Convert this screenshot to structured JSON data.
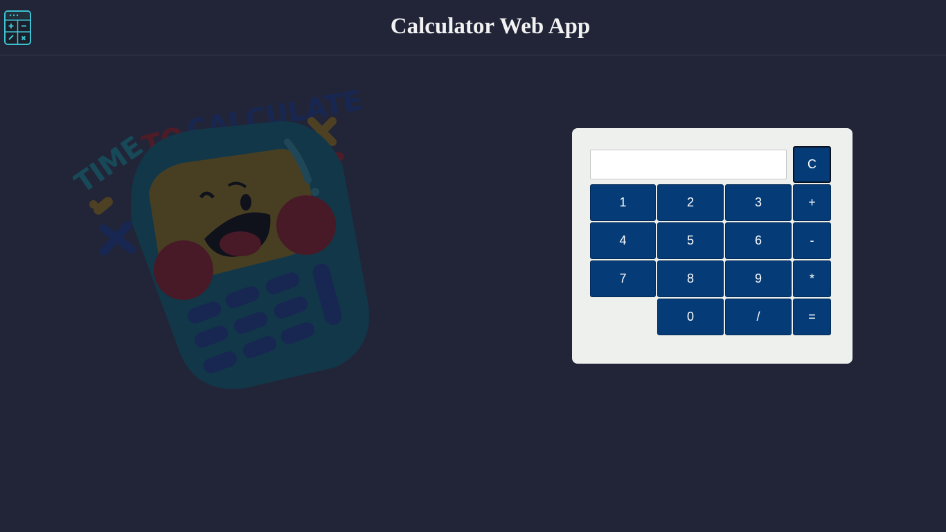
{
  "header": {
    "title": "Calculator Web App",
    "logo_icon": "calculator-icon"
  },
  "illustration": {
    "text_time": "TIME",
    "text_to": "TO",
    "text_calculate": "CALCULATE",
    "icon": "happy-calculator-illustration"
  },
  "calculator": {
    "display_value": "",
    "display_placeholder": "",
    "clear_label": "C",
    "keys": {
      "k1": "1",
      "k2": "2",
      "k3": "3",
      "plus": "+",
      "k4": "4",
      "k5": "5",
      "k6": "6",
      "minus": "-",
      "k7": "7",
      "k8": "8",
      "k9": "9",
      "multiply": "*",
      "k0": "0",
      "divide": "/",
      "equals": "="
    }
  },
  "colors": {
    "background": "#222538",
    "panel": "#edf0ed",
    "key": "#053c78",
    "accent": "#3ec1d3"
  }
}
